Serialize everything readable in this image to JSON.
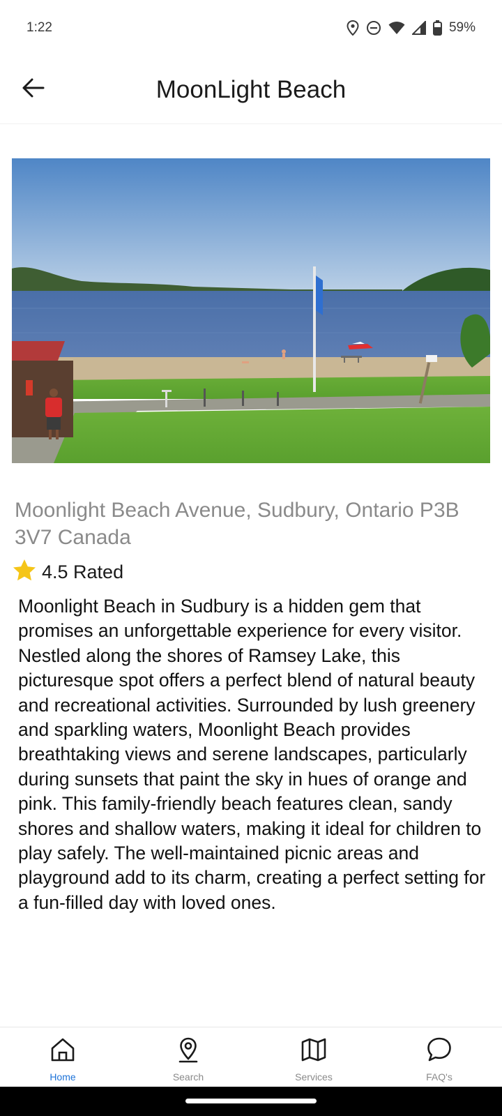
{
  "status_bar": {
    "time": "1:22",
    "battery": "59%",
    "icons": [
      "location-icon",
      "dnd-icon",
      "wifi-icon",
      "signal-icon",
      "battery-icon"
    ]
  },
  "header": {
    "title": "MoonLight Beach",
    "back_icon": "arrow-left-icon"
  },
  "place": {
    "address": "Moonlight Beach Avenue, Sudbury, Ontario P3B 3V7 Canada",
    "rating_text": "4.5 Rated",
    "rating_icon": "star-icon",
    "description": "Moonlight Beach in Sudbury is a hidden gem that promises an unforgettable experience for every visitor. Nestled along the shores of Ramsey Lake, this picturesque spot offers a perfect blend of natural beauty and recreational activities. Surrounded by lush greenery and sparkling waters, Moonlight Beach provides breathtaking views and serene landscapes, particularly during sunsets that paint the sky in hues of orange and pink. This family-friendly beach features clean, sandy shores and shallow waters, making it ideal for children to play safely. The well-maintained picnic areas and playground add to its charm, creating a perfect setting for a fun-filled day with loved ones."
  },
  "bottom_nav": {
    "items": [
      {
        "label": "Home",
        "icon": "home-icon",
        "active": true
      },
      {
        "label": "Search",
        "icon": "map-pin-icon",
        "active": false
      },
      {
        "label": "Services",
        "icon": "map-icon",
        "active": false
      },
      {
        "label": "FAQ's",
        "icon": "chat-bubble-icon",
        "active": false
      }
    ]
  },
  "colors": {
    "accent": "#1e73d8",
    "star": "#f5c518",
    "muted_text": "#8a8a8a"
  }
}
